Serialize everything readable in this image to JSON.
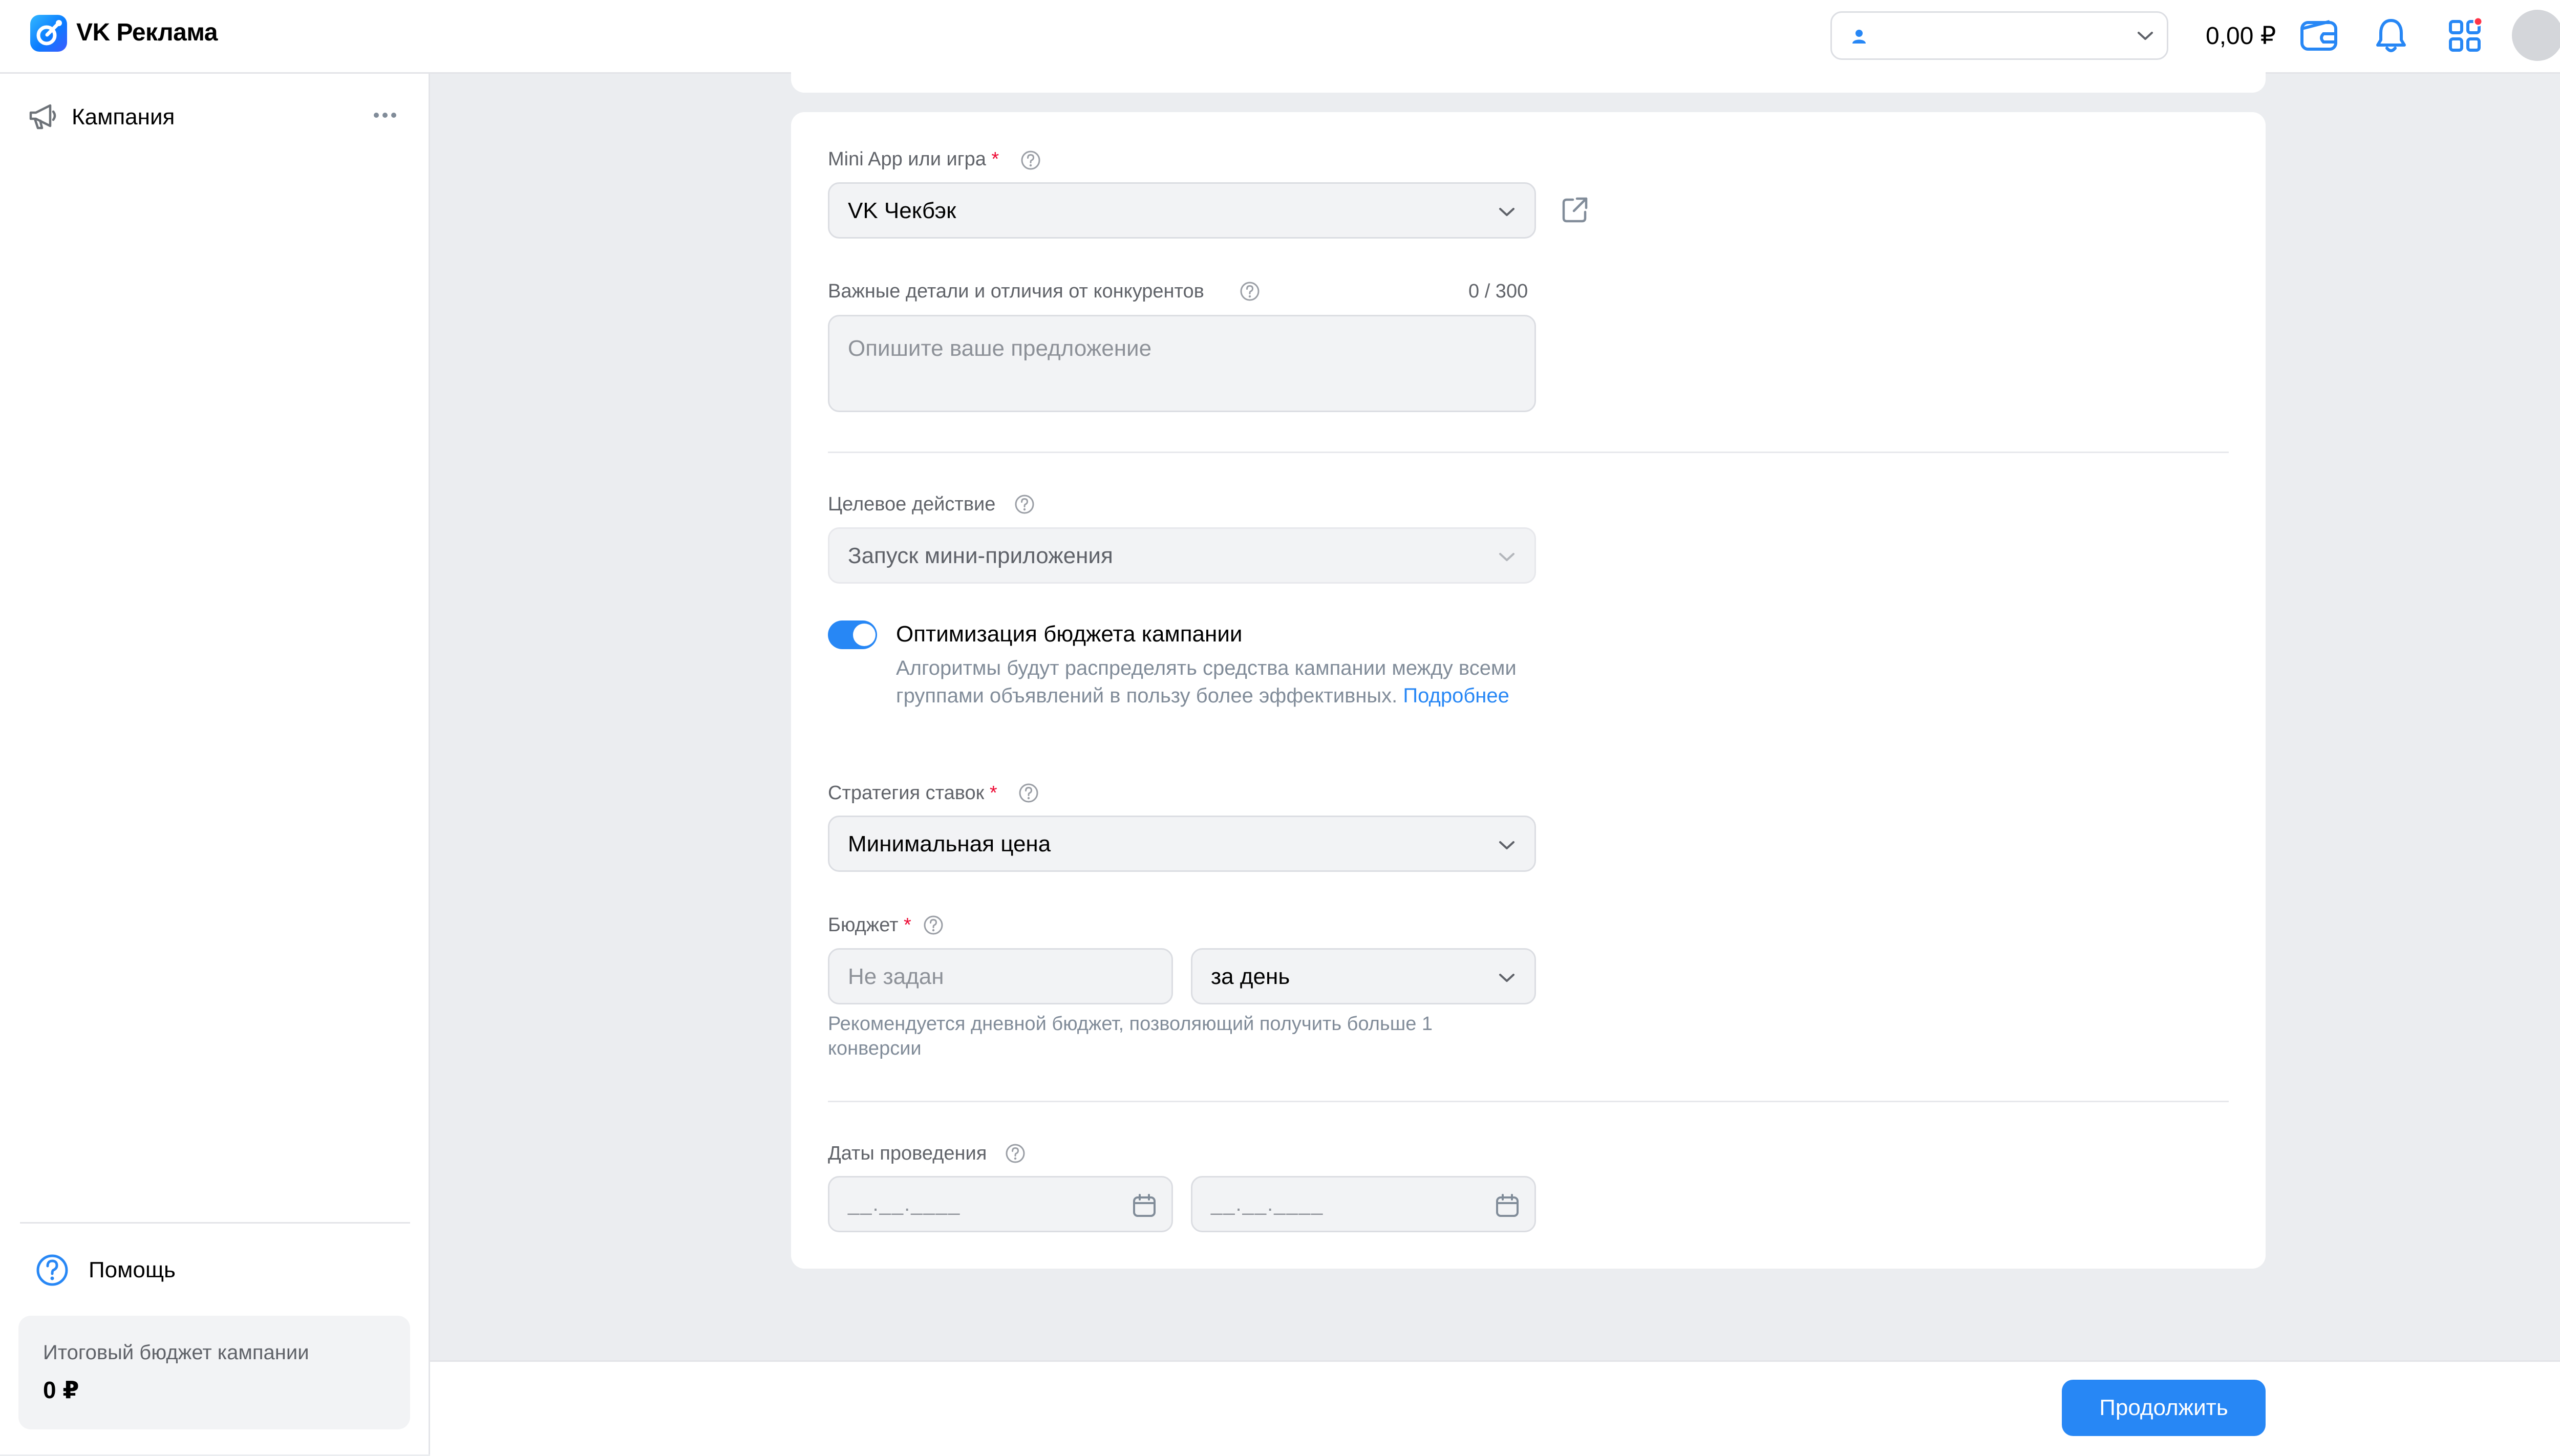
{
  "header": {
    "brand": "VK Реклама",
    "account_select_value": "",
    "balance": "0,00 ₽",
    "icons": [
      "wallet-icon",
      "bell-icon",
      "apps-icon",
      "avatar",
      "chevron-down-icon"
    ],
    "notification_dot_color": "#ff3347"
  },
  "sidebar": {
    "item_label": "Кампания",
    "help_label": "Помощь",
    "budget_caption": "Итоговый бюджет кампании",
    "budget_value": "0 ₽"
  },
  "form": {
    "mini_app": {
      "label": "Mini App или игра",
      "required_mark": "*",
      "value": "VK Чекбэк"
    },
    "details": {
      "label": "Важные детали и отличия от конкурентов",
      "counter": "0 / 300",
      "placeholder": "Опишите ваше предложение"
    },
    "target_action": {
      "label": "Целевое действие",
      "value": "Запуск мини-приложения"
    },
    "budget_optimization": {
      "enabled": true,
      "title": "Оптимизация бюджета кампании",
      "description": "Алгоритмы будут распределять средства кампании между всеми группами объявлений в пользу более эффективных.",
      "link": "Подробнее"
    },
    "bid_strategy": {
      "label": "Стратегия ставок",
      "required_mark": "*",
      "value": "Минимальная цена"
    },
    "budget": {
      "label": "Бюджет",
      "required_mark": "*",
      "placeholder": "Не задан",
      "period": "за день",
      "hint": "Рекомендуется дневной бюджет, позволяющий получить больше 1 конверсии"
    },
    "dates": {
      "label": "Даты проведения",
      "start_placeholder": "__.__.____",
      "end_placeholder": "__.__.____"
    }
  },
  "footer": {
    "continue_label": "Продолжить"
  },
  "colors": {
    "accent": "#2787f5",
    "background": "#ebedf0",
    "required": "#ed0a34"
  }
}
